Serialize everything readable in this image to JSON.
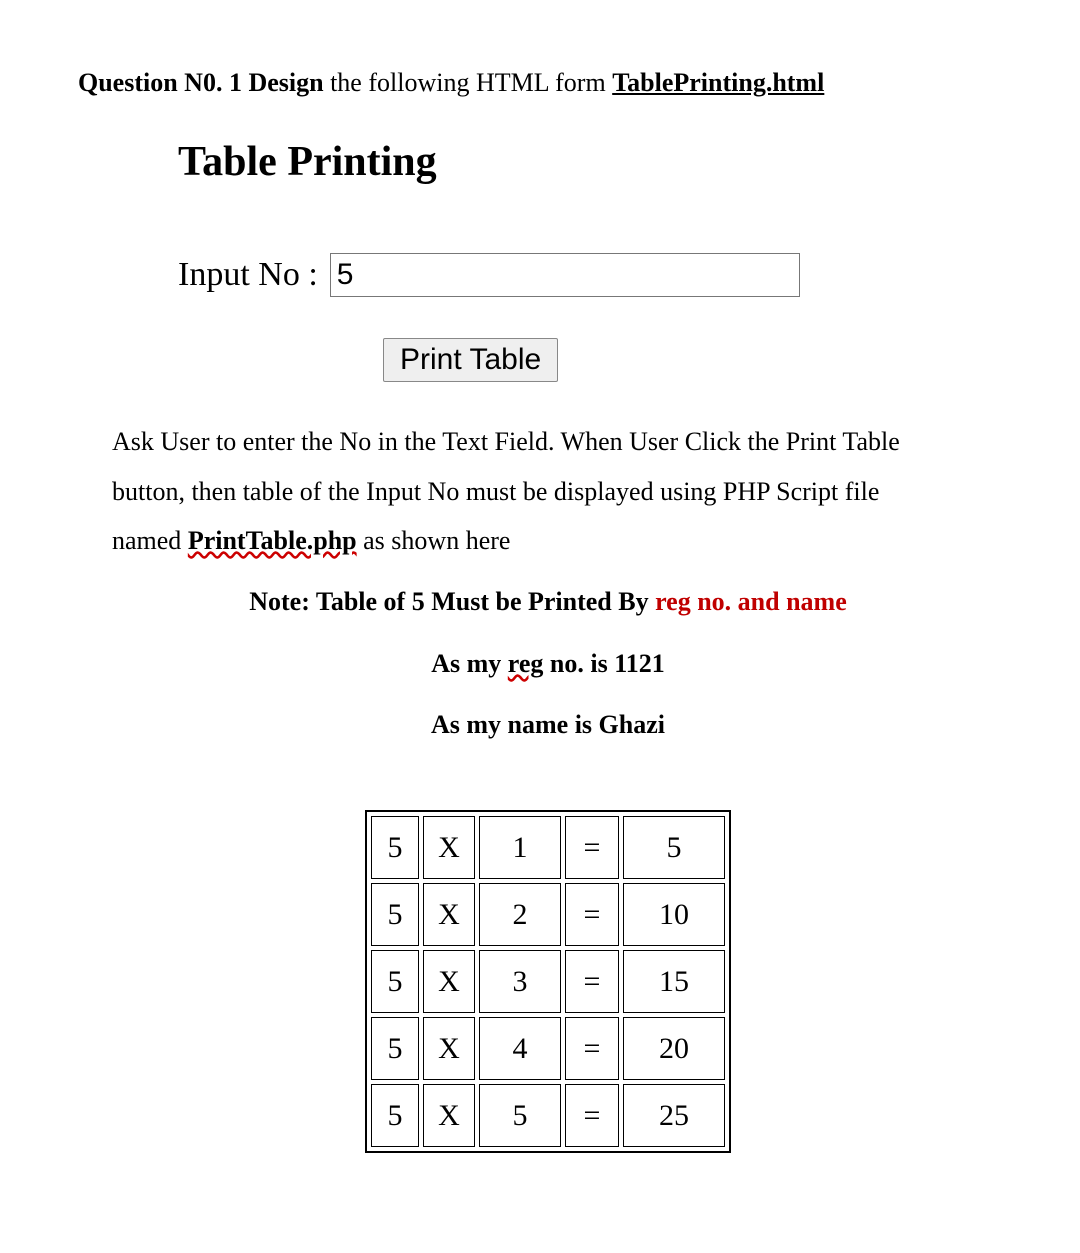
{
  "question": {
    "prefix": "Question N0. 1 Design",
    "rest": " the following HTML form ",
    "file": "TablePrinting.html"
  },
  "heading": "Table Printing",
  "form": {
    "label": "Input No :",
    "value": "5",
    "button": "Print Table"
  },
  "desc": {
    "line1a": "Ask User to enter the No in the Text Field. When User Click the Print Table",
    "line2a": "button, then table of the Input No must be displayed using PHP Script file",
    "line3a": "named ",
    "phpfile": "PrintTable.php",
    "line3b": " as shown here"
  },
  "note": {
    "black": "Note: Table of 5 Must be Printed By ",
    "red": "reg no. and name"
  },
  "info": {
    "reg_a": "As my ",
    "reg_wavy": "reg",
    "reg_b": " no. is 1121",
    "name": "As my name is Ghazi"
  },
  "chart_data": {
    "type": "table",
    "title": "Multiplication table of 5",
    "columns": [
      "a",
      "op",
      "b",
      "eq",
      "result"
    ],
    "rows": [
      {
        "a": "5",
        "op": "X",
        "b": "1",
        "eq": "=",
        "result": "5"
      },
      {
        "a": "5",
        "op": "X",
        "b": "2",
        "eq": "=",
        "result": "10"
      },
      {
        "a": "5",
        "op": "X",
        "b": "3",
        "eq": "=",
        "result": "15"
      },
      {
        "a": "5",
        "op": "X",
        "b": "4",
        "eq": "=",
        "result": "20"
      },
      {
        "a": "5",
        "op": "X",
        "b": "5",
        "eq": "=",
        "result": "25"
      }
    ]
  }
}
